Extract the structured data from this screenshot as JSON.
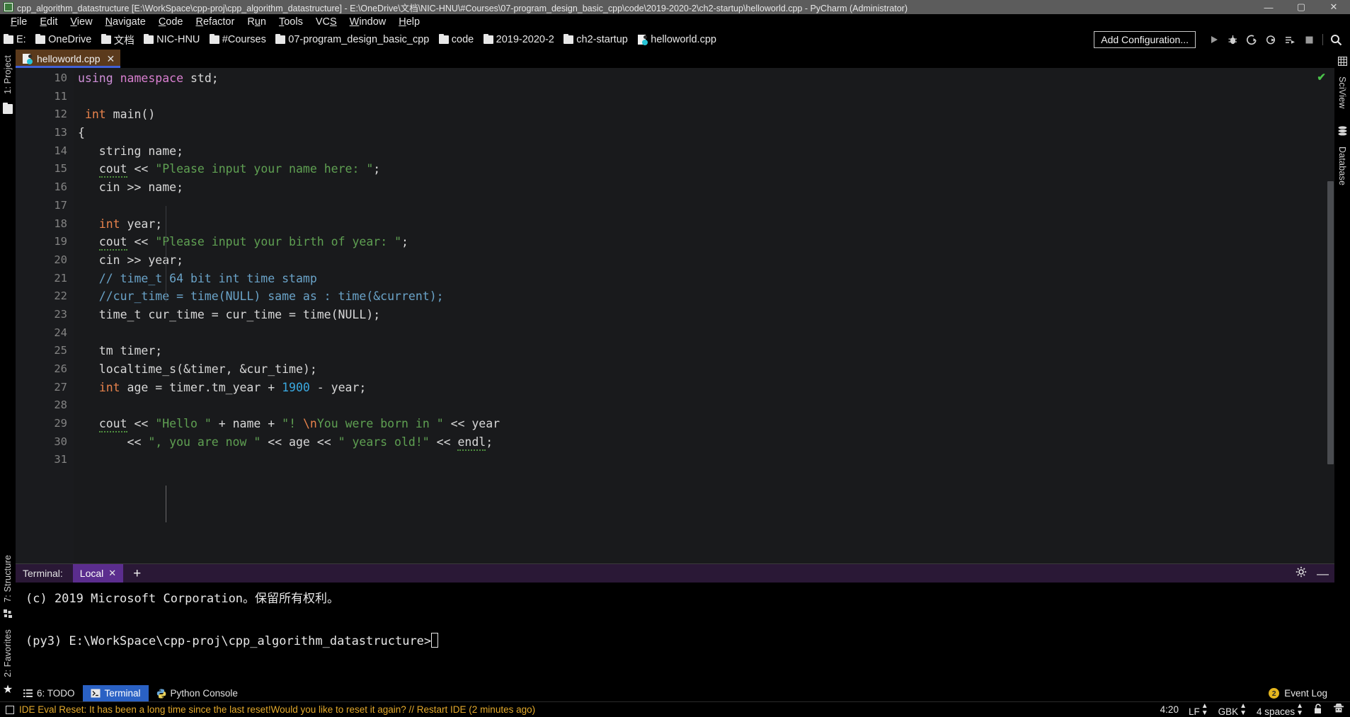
{
  "window": {
    "title": "cpp_algorithm_datastructure [E:\\WorkSpace\\cpp-proj\\cpp_algorithm_datastructure] - E:\\OneDrive\\文档\\NIC-HNU\\#Courses\\07-program_design_basic_cpp\\code\\2019-2020-2\\ch2-startup\\helloworld.cpp - PyCharm (Administrator)",
    "minimize": "—",
    "maximize": "▢",
    "close": "✕",
    "app_icon": "pycharm-icon"
  },
  "menubar": {
    "items": [
      {
        "label": "File",
        "mnemonic": "F"
      },
      {
        "label": "Edit",
        "mnemonic": "E"
      },
      {
        "label": "View",
        "mnemonic": "V"
      },
      {
        "label": "Navigate",
        "mnemonic": "N"
      },
      {
        "label": "Code",
        "mnemonic": "C"
      },
      {
        "label": "Refactor",
        "mnemonic": "R"
      },
      {
        "label": "Run",
        "mnemonic": "u"
      },
      {
        "label": "Tools",
        "mnemonic": "T"
      },
      {
        "label": "VCS",
        "mnemonic": "S"
      },
      {
        "label": "Window",
        "mnemonic": "W"
      },
      {
        "label": "Help",
        "mnemonic": "H"
      }
    ]
  },
  "navbar": {
    "breadcrumbs": [
      {
        "label": "E:",
        "icon": "folder-icon"
      },
      {
        "label": "OneDrive",
        "icon": "folder-icon"
      },
      {
        "label": "文档",
        "icon": "folder-icon"
      },
      {
        "label": "NIC-HNU",
        "icon": "folder-icon"
      },
      {
        "label": "#Courses",
        "icon": "folder-icon"
      },
      {
        "label": "07-program_design_basic_cpp",
        "icon": "folder-icon"
      },
      {
        "label": "code",
        "icon": "folder-icon"
      },
      {
        "label": "2019-2020-2",
        "icon": "folder-icon"
      },
      {
        "label": "ch2-startup",
        "icon": "folder-icon"
      },
      {
        "label": "helloworld.cpp",
        "icon": "cpp-file-icon"
      }
    ],
    "separator": "❯",
    "add_configuration": "Add Configuration...",
    "buttons": [
      {
        "name": "run-button",
        "icon": "play-icon"
      },
      {
        "name": "debug-button",
        "icon": "bug-icon"
      },
      {
        "name": "run-with-coverage-button",
        "icon": "coverage-icon"
      },
      {
        "name": "profile-button",
        "icon": "profile-icon"
      },
      {
        "name": "run-tests-button",
        "icon": "run-list-icon"
      },
      {
        "name": "stop-button",
        "icon": "stop-icon"
      },
      {
        "name": "search-everywhere-button",
        "icon": "search-icon"
      }
    ]
  },
  "left_strip": {
    "project_label": "1: Project",
    "structure_label": "7: Structure",
    "favorites_label": "2: Favorites"
  },
  "right_strip": {
    "sciview_label": "SciView",
    "database_label": "Database"
  },
  "editor": {
    "tab": {
      "label": "helloworld.cpp",
      "close": "✕",
      "icon": "cpp-file-icon"
    },
    "inspection_status": "✔",
    "first_line_number": 10,
    "lines": [
      {
        "n": 10,
        "tokens": [
          {
            "t": "using",
            "c": "kw"
          },
          {
            "t": " ",
            "c": "t"
          },
          {
            "t": "namespace",
            "c": "kw2"
          },
          {
            "t": " std;",
            "c": "t"
          }
        ]
      },
      {
        "n": 11,
        "tokens": []
      },
      {
        "n": 12,
        "tokens": [
          {
            "t": " ",
            "c": "t"
          },
          {
            "t": "int",
            "c": "k"
          },
          {
            "t": " main()",
            "c": "t"
          }
        ]
      },
      {
        "n": 13,
        "tokens": [
          {
            "t": "{",
            "c": "t"
          }
        ],
        "fold": true
      },
      {
        "n": 14,
        "tokens": [
          {
            "t": "   string name;",
            "c": "t"
          }
        ]
      },
      {
        "n": 15,
        "tokens": [
          {
            "t": "   ",
            "c": "t"
          },
          {
            "t": "cout",
            "c": "t sq"
          },
          {
            "t": " << ",
            "c": "t"
          },
          {
            "t": "\"Please input your name here: \"",
            "c": "s"
          },
          {
            "t": ";",
            "c": "t"
          }
        ]
      },
      {
        "n": 16,
        "tokens": [
          {
            "t": "   cin >> name;",
            "c": "t"
          }
        ]
      },
      {
        "n": 17,
        "tokens": []
      },
      {
        "n": 18,
        "tokens": [
          {
            "t": "   ",
            "c": "t"
          },
          {
            "t": "int",
            "c": "k"
          },
          {
            "t": " year;",
            "c": "t"
          }
        ]
      },
      {
        "n": 19,
        "tokens": [
          {
            "t": "   ",
            "c": "t"
          },
          {
            "t": "cout",
            "c": "t sq"
          },
          {
            "t": " << ",
            "c": "t"
          },
          {
            "t": "\"Please input your birth of year: \"",
            "c": "s"
          },
          {
            "t": ";",
            "c": "t"
          }
        ]
      },
      {
        "n": 20,
        "tokens": [
          {
            "t": "   cin >> year;",
            "c": "t"
          }
        ]
      },
      {
        "n": 21,
        "tokens": [
          {
            "t": "   // time_t 64 bit int time stamp",
            "c": "c"
          }
        ]
      },
      {
        "n": 22,
        "tokens": [
          {
            "t": "   //cur_time = time(NULL) same as : time(&current);",
            "c": "c"
          }
        ]
      },
      {
        "n": 23,
        "tokens": [
          {
            "t": "   time_t cur_time = cur_time = time(NULL);",
            "c": "t"
          }
        ]
      },
      {
        "n": 24,
        "tokens": []
      },
      {
        "n": 25,
        "tokens": [
          {
            "t": "   tm timer;",
            "c": "t"
          }
        ]
      },
      {
        "n": 26,
        "tokens": [
          {
            "t": "   localtime_s(&timer, &cur_time);",
            "c": "t"
          }
        ]
      },
      {
        "n": 27,
        "tokens": [
          {
            "t": "   ",
            "c": "t"
          },
          {
            "t": "int",
            "c": "k"
          },
          {
            "t": " age = timer.tm_year + ",
            "c": "t"
          },
          {
            "t": "1900",
            "c": "n"
          },
          {
            "t": " - year;",
            "c": "t"
          }
        ]
      },
      {
        "n": 28,
        "tokens": []
      },
      {
        "n": 29,
        "tokens": [
          {
            "t": "   ",
            "c": "t"
          },
          {
            "t": "cout",
            "c": "t sq"
          },
          {
            "t": " << ",
            "c": "t"
          },
          {
            "t": "\"Hello \"",
            "c": "s"
          },
          {
            "t": " + name + ",
            "c": "t"
          },
          {
            "t": "\"! ",
            "c": "s"
          },
          {
            "t": "\\n",
            "c": "esc"
          },
          {
            "t": "You were born in \"",
            "c": "s"
          },
          {
            "t": " << year",
            "c": "t"
          }
        ]
      },
      {
        "n": 30,
        "tokens": [
          {
            "t": "       << ",
            "c": "t"
          },
          {
            "t": "\", you are now \"",
            "c": "s"
          },
          {
            "t": " << age << ",
            "c": "t"
          },
          {
            "t": "\" years old!\"",
            "c": "s"
          },
          {
            "t": " << ",
            "c": "t"
          },
          {
            "t": "endl",
            "c": "t sq"
          },
          {
            "t": ";",
            "c": "t"
          }
        ]
      },
      {
        "n": 31,
        "tokens": []
      }
    ]
  },
  "terminal": {
    "header_label": "Terminal:",
    "tab_label": "Local",
    "tab_close": "✕",
    "add_tab": "+",
    "settings_icon": "gear-icon",
    "hide_icon": "minimize-icon",
    "lines": [
      "(c) 2019 Microsoft Corporation。保留所有权利。",
      "",
      "(py3) E:\\WorkSpace\\cpp-proj\\cpp_algorithm_datastructure>"
    ]
  },
  "bottom_tabs": [
    {
      "label": "6: TODO",
      "icon": "todo-icon",
      "active": false
    },
    {
      "label": "Terminal",
      "icon": "terminal-icon",
      "active": true
    },
    {
      "label": "Python Console",
      "icon": "python-icon",
      "active": false
    }
  ],
  "event_log": {
    "count": "2",
    "label": "Event Log"
  },
  "statusbar": {
    "message": "IDE Eval Reset: It has been a long time since the last reset!Would you like to reset it again? // Restart IDE (2 minutes ago)",
    "message_icon": "notification-icon",
    "caret_position": "4:20",
    "line_separator": "LF",
    "encoding": "GBK",
    "indent": "4 spaces",
    "lock_icon": "unlocked-icon",
    "inspector_icon": "hector-icon"
  },
  "colors": {
    "accent_blue": "#2a61c4",
    "tab_active": "#5b3a1c",
    "terminal_tab": "#5b2d8e",
    "status_warning": "#e3a92b",
    "string_green": "#5fa052",
    "comment_blue": "#6aa3c8",
    "keyword_orange": "#e8834c",
    "number_blue": "#3aa9e0"
  }
}
